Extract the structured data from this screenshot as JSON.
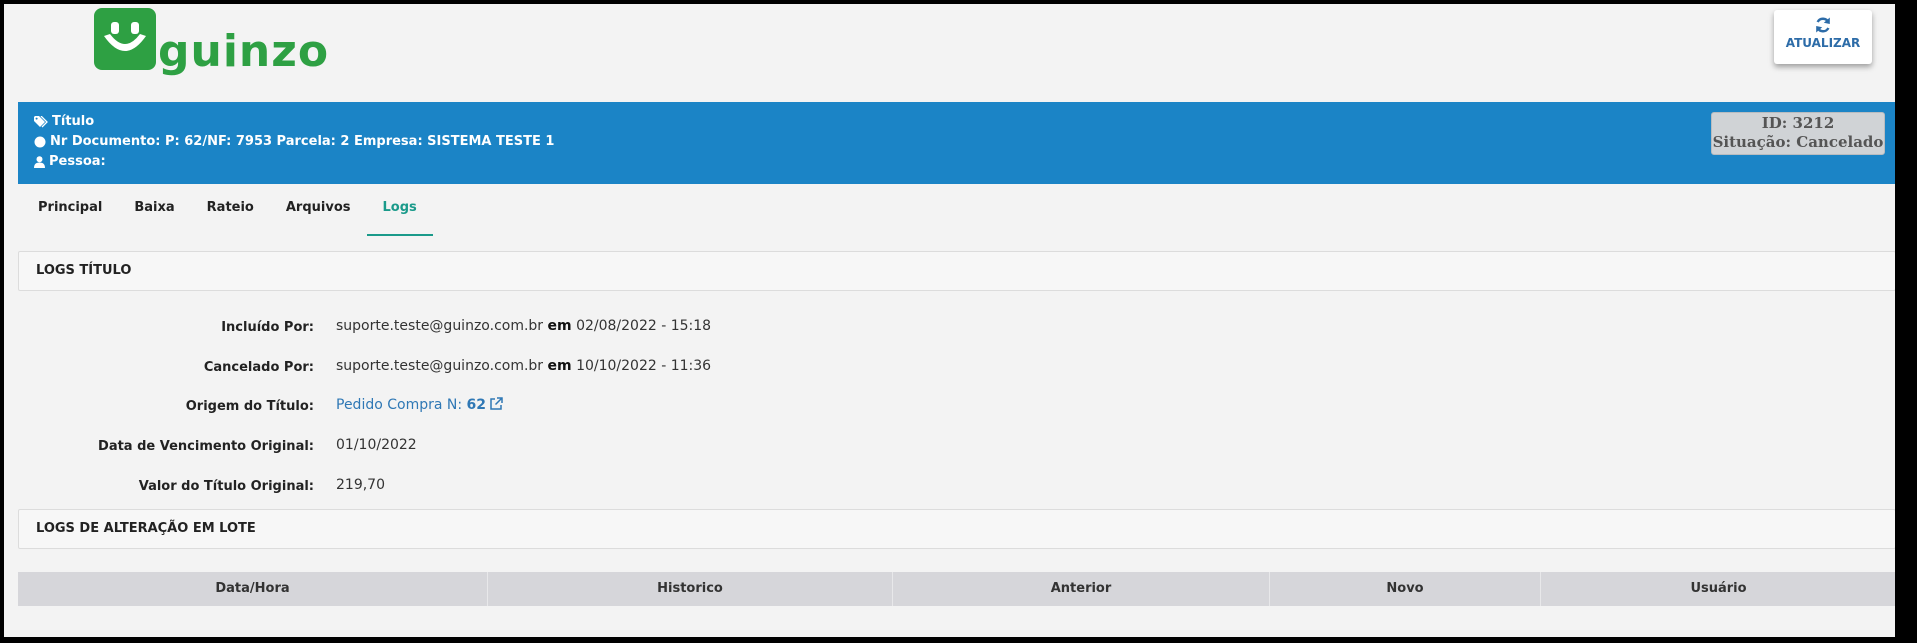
{
  "brand": {
    "logo_text": "guinzo",
    "accent": "#2ea043"
  },
  "toolbar": {
    "refresh_label": "ATUALIZAR",
    "refresh_icon": "refresh-icon"
  },
  "banner": {
    "title": "Título",
    "document": "Nr Documento: P: 62/NF: 7953 Parcela: 2 Empresa: SISTEMA TESTE 1",
    "person": "Pessoa:",
    "id_line": "ID: 3212",
    "status_line": "Situação: Cancelado",
    "color": "#1b84c6"
  },
  "tabs": [
    {
      "label": "Principal",
      "active": false
    },
    {
      "label": "Baixa",
      "active": false
    },
    {
      "label": "Rateio",
      "active": false
    },
    {
      "label": "Arquivos",
      "active": false
    },
    {
      "label": "Logs",
      "active": true
    }
  ],
  "logs_titulo": {
    "header": "LOGS TÍTULO",
    "included": {
      "label": "Incluído Por:",
      "user": "suporte.teste@guinzo.com.br",
      "sep": "em",
      "datetime": "02/08/2022 - 15:18"
    },
    "cancelled": {
      "label": "Cancelado Por:",
      "user": "suporte.teste@guinzo.com.br",
      "sep": "em",
      "datetime": "10/10/2022 - 11:36"
    },
    "origin": {
      "label": "Origem do Título:",
      "link_text": "Pedido Compra N:",
      "number": "62"
    },
    "due_date": {
      "label": "Data de Vencimento Original:",
      "value": "01/10/2022"
    },
    "original_value": {
      "label": "Valor do Título Original:",
      "value": "219,70"
    }
  },
  "logs_lote": {
    "header": "LOGS DE ALTERAÇÃO EM LOTE",
    "columns": [
      "Data/Hora",
      "Historico",
      "Anterior",
      "Novo",
      "Usuário"
    ]
  }
}
